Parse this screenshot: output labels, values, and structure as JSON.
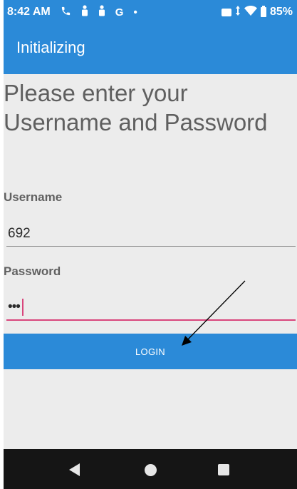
{
  "status_bar": {
    "time": "8:42 AM",
    "left_icons": [
      "phone-icon",
      "person-icon",
      "person-icon",
      "google-icon",
      "dot-icon"
    ],
    "google_glyph": "G",
    "dot_glyph": "•",
    "right_icons": [
      "message-icon",
      "data-arrows-icon",
      "wifi-icon",
      "battery-icon"
    ],
    "battery_percent": "85%"
  },
  "app_bar": {
    "title": "Initializing"
  },
  "form": {
    "prompt": "Please enter your Username and Password",
    "username_label": "Username",
    "username_value": "692",
    "password_label": "Password",
    "password_value": "•••",
    "login_label": "LOGIN"
  },
  "nav_bar": {
    "buttons": [
      "back-icon",
      "home-icon",
      "recents-icon"
    ]
  },
  "colors": {
    "primary": "#2b8ad8",
    "accent": "#d9457c",
    "background": "#ececec",
    "nav_bar": "#151515"
  }
}
